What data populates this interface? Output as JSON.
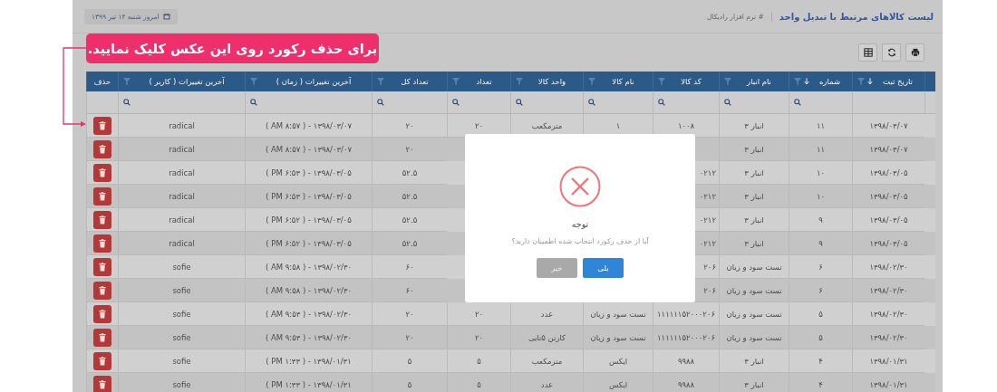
{
  "header": {
    "title": "لیست کالاهای مرتبط با تبدیل واحد",
    "breadcrumb": "# نرم افزار رادیکال",
    "date": "امروز شنبه ۱۴ تیر ۱۳۹۹"
  },
  "callout": {
    "text": "برای حذف رکورد روی این عکس کلیک نمایید."
  },
  "table": {
    "columns": [
      {
        "label": "تاریخ ثبت",
        "sort": true,
        "filter": true,
        "search": false
      },
      {
        "label": "شماره",
        "sort": true,
        "filter": true,
        "search": true
      },
      {
        "label": "نام انبار",
        "sort": false,
        "filter": true,
        "search": true
      },
      {
        "label": "کد کالا",
        "sort": false,
        "filter": true,
        "search": true
      },
      {
        "label": "نام کالا",
        "sort": false,
        "filter": true,
        "search": true
      },
      {
        "label": "واحد کالا",
        "sort": false,
        "filter": true,
        "search": true
      },
      {
        "label": "تعداد",
        "sort": false,
        "filter": true,
        "search": true
      },
      {
        "label": "تعداد کل",
        "sort": false,
        "filter": true,
        "search": true
      },
      {
        "label": "آخرین تغییرات ( زمان )",
        "sort": false,
        "filter": true,
        "search": true
      },
      {
        "label": "آخرین تغییرات ( کاربر )",
        "sort": false,
        "filter": true,
        "search": true
      },
      {
        "label": "حذف",
        "sort": false,
        "filter": false,
        "search": false
      }
    ],
    "rows": [
      {
        "cells": [
          "۱۳۹۸/۰۳/۰۷",
          "۱۱",
          "انبار ۳",
          "۱۰۰۸",
          "۱",
          "مترمکعب",
          "۲۰",
          "۲۰",
          "( AM ۸:۵۷ ) - ۱۳۹۸/۰۳/۰۷",
          "radical"
        ]
      },
      {
        "cells": [
          "۱۳۹۸/۰۳/۰۷",
          "۱۱",
          "انبار ۳",
          null,
          null,
          null,
          null,
          "۲۰",
          "( AM ۸:۵۷ ) - ۱۳۹۸/۰۳/۰۷",
          "radical"
        ]
      },
      {
        "cells": [
          "۱۳۹۸/۰۳/۰۵",
          "۱۰",
          "انبار ۳",
          {
            "text": "۰۲۱۲",
            "cut": true
          },
          null,
          null,
          null,
          "۵۲.۵",
          "( PM ۶:۵۳ ) - ۱۳۹۸/۰۳/۰۵",
          "radical"
        ]
      },
      {
        "cells": [
          "۱۳۹۸/۰۳/۰۵",
          "۱۰",
          "انبار ۳",
          {
            "text": "۰۲۱۲",
            "cut": true
          },
          null,
          null,
          null,
          "۵۲.۵",
          "( PM ۶:۵۳ ) - ۱۳۹۸/۰۳/۰۵",
          "radical"
        ]
      },
      {
        "cells": [
          "۱۳۹۸/۰۳/۰۵",
          "۹",
          "انبار ۳",
          {
            "text": "۰۲۱۲",
            "cut": true
          },
          null,
          null,
          null,
          "۵۲.۵",
          "( PM ۶:۵۲ ) - ۱۳۹۸/۰۳/۰۵",
          "radical"
        ]
      },
      {
        "cells": [
          "۱۳۹۸/۰۳/۰۵",
          "۹",
          "انبار ۳",
          {
            "text": "۰۲۱۲",
            "cut": true
          },
          null,
          null,
          null,
          "۵۲.۵",
          "( PM ۶:۵۲ ) - ۱۳۹۸/۰۳/۰۵",
          "radical"
        ]
      },
      {
        "cells": [
          "۱۳۹۸/۰۲/۳۰",
          "۶",
          "تست سود و زیان",
          {
            "text": "۲۰۶",
            "cut": true
          },
          null,
          null,
          null,
          "۶۰",
          "( AM ۹:۵۸ ) - ۱۳۹۸/۰۲/۳۰",
          "sofie"
        ]
      },
      {
        "cells": [
          "۱۳۹۸/۰۲/۳۰",
          "۶",
          "تست سود و زیان",
          {
            "text": "۲۰۶",
            "cut": true
          },
          null,
          null,
          null,
          "۶۰",
          "( AM ۹:۵۸ ) - ۱۳۹۸/۰۲/۳۰",
          "sofie"
        ]
      },
      {
        "cells": [
          "۱۳۹۸/۰۲/۳۰",
          "۵",
          "تست سود و زیان",
          "۱۱۱۱۱۱۵۲۰۰۰۲۰۶",
          "تست سود و زیان",
          "عدد",
          "۲۰",
          "۲۰",
          "( AM ۹:۵۳ ) - ۱۳۹۸/۰۲/۳۰",
          "sofie"
        ]
      },
      {
        "cells": [
          "۱۳۹۸/۰۲/۳۰",
          "۵",
          "تست سود و زیان",
          "۱۱۱۱۱۱۵۲۰۰۰۲۰۶",
          "تست سود و زیان",
          "کارتن ۵تایی",
          "۲۰",
          "۲۰",
          "( AM ۹:۵۳ ) - ۱۳۹۸/۰۲/۳۰",
          "sofie"
        ]
      },
      {
        "cells": [
          "۱۳۹۸/۰۱/۳۱",
          "۴",
          "انبار ۳",
          "۹۹۸۸",
          "ایکس",
          "مترمکعب",
          "۵",
          "۵",
          "( PM ۱:۳۳ ) - ۱۳۹۸/۰۱/۳۱",
          "sofie"
        ]
      },
      {
        "cells": [
          "۱۳۹۸/۰۱/۳۱",
          "۴",
          "انبار ۳",
          "۹۹۸۸",
          "ایکس",
          "عدد",
          "۵",
          "۵",
          "( PM ۱:۳۳ ) - ۱۳۹۸/۰۱/۳۱",
          "sofie"
        ]
      }
    ]
  },
  "modal": {
    "title": "توجه",
    "message": "آیا از حذف رکورد انتخاب شده اطمینان دارید؟",
    "buttons": [
      {
        "label": "بلی",
        "kind": "primary"
      },
      {
        "label": "خیر",
        "kind": "secondary"
      }
    ]
  }
}
